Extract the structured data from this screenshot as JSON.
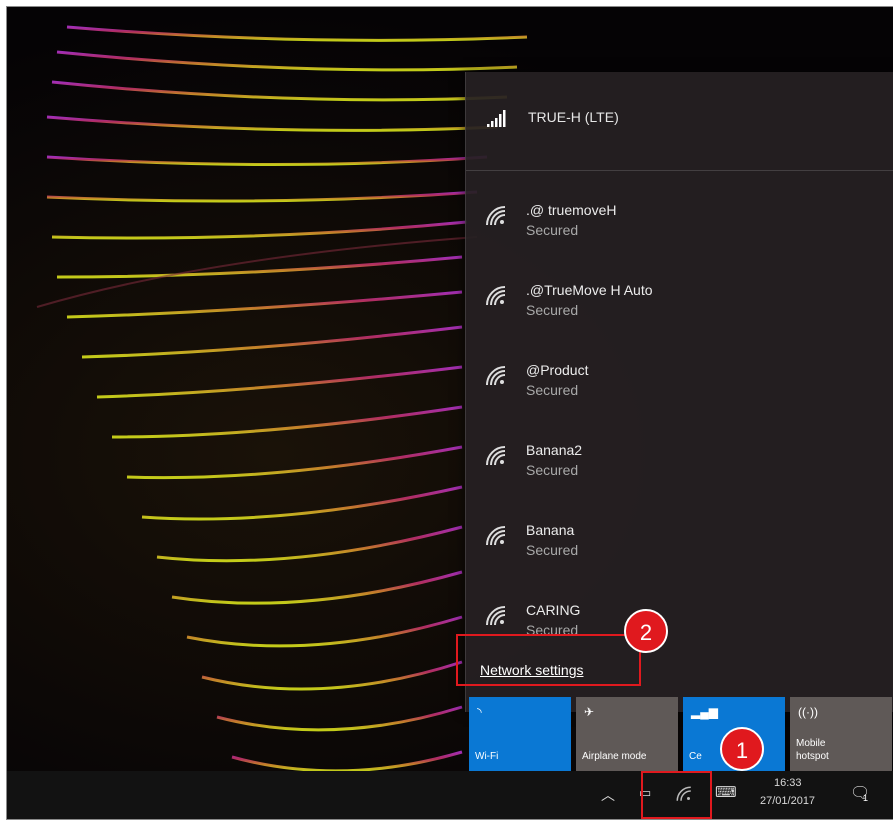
{
  "cellular": {
    "name": "TRUE-H (LTE)",
    "icon": "signal-bars-icon"
  },
  "networks": [
    {
      "name": ".@  truemoveH",
      "status": "Secured",
      "icon": "wifi-icon"
    },
    {
      "name": ".@TrueMove H Auto",
      "status": "Secured",
      "icon": "wifi-icon"
    },
    {
      "name": "@Product",
      "status": "Secured",
      "icon": "wifi-icon"
    },
    {
      "name": "Banana2",
      "status": "Secured",
      "icon": "wifi-icon"
    },
    {
      "name": "Banana",
      "status": "Secured",
      "icon": "wifi-icon"
    },
    {
      "name": "CARING",
      "status": "Secured",
      "icon": "wifi-icon"
    }
  ],
  "network_settings_label": "Network settings",
  "tiles": [
    {
      "label": "Wi-Fi",
      "icon": "wifi-icon",
      "state": "on"
    },
    {
      "label": "Airplane mode",
      "icon": "airplane-icon",
      "state": "off"
    },
    {
      "label": "Ce",
      "icon": "cellular-icon",
      "state": "on"
    },
    {
      "label": "Mobile hotspot",
      "icon": "hotspot-icon",
      "state": "off"
    }
  ],
  "taskbar": {
    "time": "16:33",
    "date": "27/01/2017",
    "notification_count": "1"
  },
  "annotations": {
    "badge1": "1",
    "badge2": "2"
  },
  "colors": {
    "accent": "#0a78d4",
    "annotation": "#e0191e"
  }
}
